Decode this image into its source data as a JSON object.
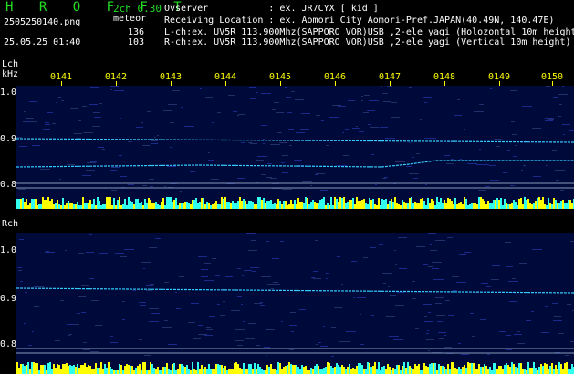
{
  "header": {
    "app_title": "H R O F F T",
    "version": "2ch 0.30",
    "filename": "2505250140.png",
    "mode": "meteor",
    "date_time": "25.05.25 01:40",
    "count_l": "136",
    "count_r": "103",
    "observer": "Ovserver           : ex. JR7CYX [ kid ]",
    "location": "Receiving Location : ex. Aomori City Aomori-Pref.JAPAN(40.49N, 140.47E)",
    "lch": "L-ch:ex. UV5R 113.900Mhz(SAPPORO VOR)USB ,2-ele yagi (Holozontal 10m height)",
    "rch": "R-ch:ex. UV5R 113.900Mhz(SAPPORO VOR)USB ,2-ele yagi (Vertical 10m height)"
  },
  "axis": {
    "lch_label": "Lch",
    "khz_label": "kHz",
    "rch_label": "Rch",
    "time_ticks": [
      "0141",
      "0142",
      "0143",
      "0144",
      "0145",
      "0146",
      "0147",
      "0148",
      "0149",
      "0150"
    ],
    "lch_y_ticks": [
      "1.0",
      "0.9",
      "0.8"
    ],
    "rch_y_ticks": [
      "1.0",
      "0.9",
      "0.8"
    ]
  },
  "colors": {
    "background": "#000000",
    "panel": "#000a3a",
    "signal": "#33ccff",
    "bars_yellow": "#ffff00",
    "bars_cyan": "#33ffee",
    "text_green": "#22dd22",
    "tick_yellow": "#ffff00"
  }
}
